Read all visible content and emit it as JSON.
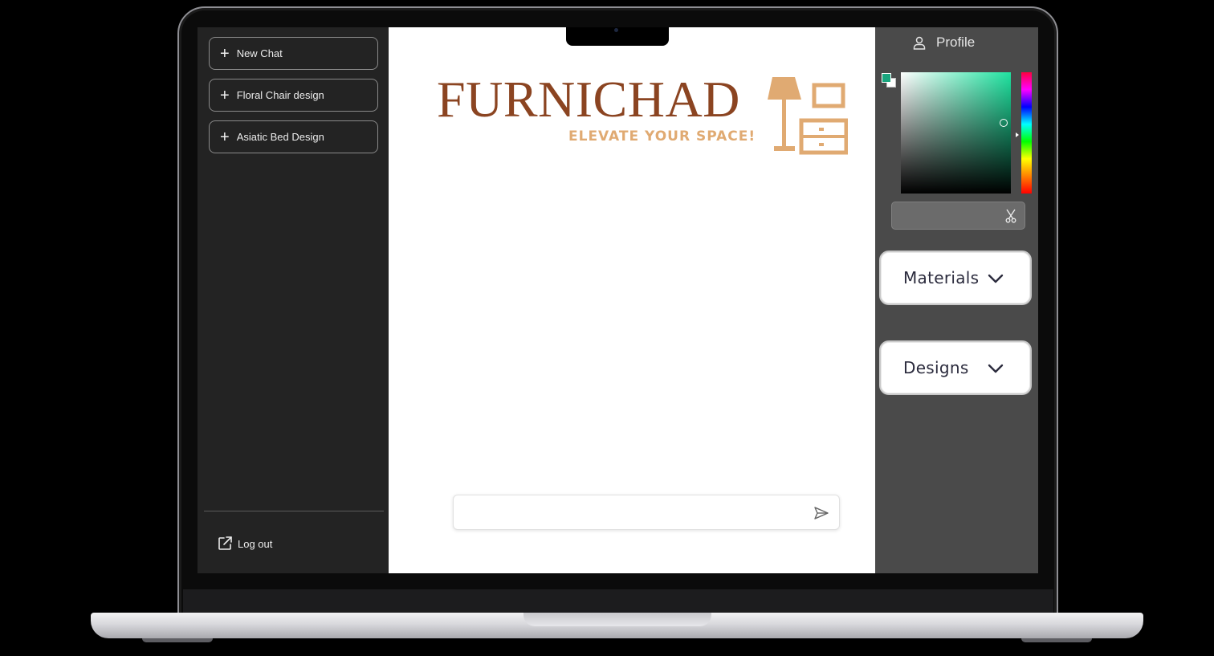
{
  "sidebar": {
    "chats": [
      {
        "label": "New Chat"
      },
      {
        "label": "Floral Chair design"
      },
      {
        "label": "Asiatic Bed Design"
      }
    ],
    "logout_label": "Log out"
  },
  "main": {
    "logo": {
      "wordmark": "FURNICHAD",
      "tagline": "ELEVATE YOUR SPACE!"
    },
    "chat_input": {
      "value": "",
      "placeholder": ""
    }
  },
  "right_panel": {
    "profile_label": "Profile",
    "color_picker": {
      "selected_color": "#1aa57e",
      "hue_color": "#1fe3a0",
      "hex_value": ""
    },
    "dropdowns": [
      {
        "label": "Materials"
      },
      {
        "label": "Designs"
      }
    ]
  },
  "colors": {
    "brand_brown": "#8b4421",
    "brand_tan": "#e0aa72",
    "sidebar_bg": "#232323",
    "panel_bg": "#4a4a4a"
  },
  "icons": {
    "plus": "plus-icon",
    "logout": "external-link-icon",
    "send": "send-icon",
    "profile": "user-icon",
    "scissors": "scissors-icon",
    "chevron": "chevron-down-icon"
  }
}
